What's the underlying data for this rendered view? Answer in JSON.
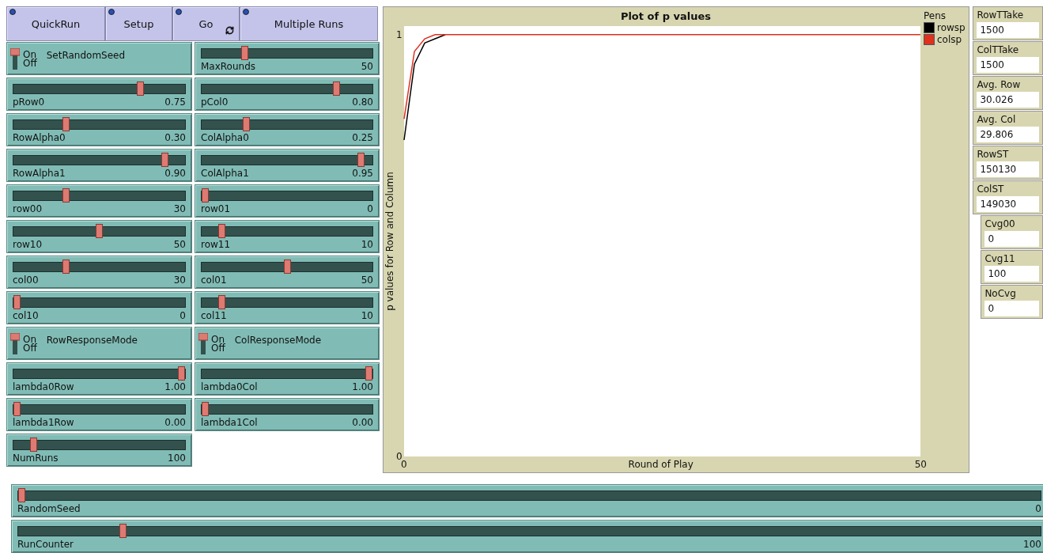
{
  "buttons": [
    {
      "label": "QuickRun",
      "forever": false
    },
    {
      "label": "Setup",
      "forever": false
    },
    {
      "label": "Go",
      "forever": true
    },
    {
      "label": "Multiple Runs",
      "forever": false
    }
  ],
  "widgets": [
    {
      "kind": "switch",
      "label": "SetRandomSeed",
      "on_label": "On",
      "off_label": "Off",
      "on": true
    },
    {
      "kind": "slider",
      "label": "MaxRounds",
      "value": "50",
      "level": 0.24
    },
    {
      "kind": "slider",
      "label": "pRow0",
      "value": "0.75",
      "level": 0.75
    },
    {
      "kind": "slider",
      "label": "pCol0",
      "value": "0.80",
      "level": 0.8
    },
    {
      "kind": "slider",
      "label": "RowAlpha0",
      "value": "0.30",
      "level": 0.3
    },
    {
      "kind": "slider",
      "label": "ColAlpha0",
      "value": "0.25",
      "level": 0.25
    },
    {
      "kind": "slider",
      "label": "RowAlpha1",
      "value": "0.90",
      "level": 0.9
    },
    {
      "kind": "slider",
      "label": "ColAlpha1",
      "value": "0.95",
      "level": 0.95
    },
    {
      "kind": "slider",
      "label": "row00",
      "value": "30",
      "level": 0.3
    },
    {
      "kind": "slider",
      "label": "row01",
      "value": "0",
      "level": 0
    },
    {
      "kind": "slider",
      "label": "row10",
      "value": "50",
      "level": 0.5
    },
    {
      "kind": "slider",
      "label": "row11",
      "value": "10",
      "level": 0.1
    },
    {
      "kind": "slider",
      "label": "col00",
      "value": "30",
      "level": 0.3
    },
    {
      "kind": "slider",
      "label": "col01",
      "value": "50",
      "level": 0.5
    },
    {
      "kind": "slider",
      "label": "col10",
      "value": "0",
      "level": 0
    },
    {
      "kind": "slider",
      "label": "col11",
      "value": "10",
      "level": 0.1
    },
    {
      "kind": "switch",
      "label": "RowResponseMode",
      "on_label": "On",
      "off_label": "Off",
      "on": true
    },
    {
      "kind": "switch",
      "label": "ColResponseMode",
      "on_label": "On",
      "off_label": "Off",
      "on": true
    },
    {
      "kind": "slider",
      "label": "lambda0Row",
      "value": "1.00",
      "level": 1
    },
    {
      "kind": "slider",
      "label": "lambda0Col",
      "value": "1.00",
      "level": 1
    },
    {
      "kind": "slider",
      "label": "lambda1Row",
      "value": "0.00",
      "level": 0
    },
    {
      "kind": "slider",
      "label": "lambda1Col",
      "value": "0.00",
      "level": 0
    },
    {
      "kind": "slider",
      "label": "NumRuns",
      "value": "100",
      "level": 0.1
    }
  ],
  "plot": {
    "legend_title": "Pens",
    "chart_data": {
      "type": "line",
      "legend": true,
      "title": "Plot of p values",
      "xlabel": "Round of Play",
      "ylabel": "p values for Row and Column",
      "x": [
        0,
        1,
        2,
        3,
        4,
        5,
        50
      ],
      "xlim": [
        0,
        50
      ],
      "ylim": [
        0,
        1.02
      ],
      "xticks": [
        0,
        50
      ],
      "yticks": [
        0,
        1
      ],
      "series": [
        {
          "name": "rowsp",
          "color": "#000000",
          "values": [
            0.75,
            0.93,
            0.98,
            0.99,
            1,
            null,
            null
          ]
        },
        {
          "name": "colsp",
          "color": "#e0301e",
          "values": [
            0.8,
            0.96,
            0.99,
            1,
            1,
            1,
            1
          ]
        }
      ]
    }
  },
  "monitors": [
    {
      "label": "RowTTake",
      "value": "1500",
      "indented": false
    },
    {
      "label": "ColTTake",
      "value": "1500",
      "indented": false
    },
    {
      "label": "Avg. Row",
      "value": "30.026",
      "indented": false
    },
    {
      "label": "Avg. Col",
      "value": "29.806",
      "indented": false
    },
    {
      "label": "RowST",
      "value": "150130",
      "indented": false
    },
    {
      "label": "ColST",
      "value": "149030",
      "indented": false
    },
    {
      "label": "Cvg00",
      "value": "0",
      "indented": true
    },
    {
      "label": "Cvg11",
      "value": "100",
      "indented": true
    },
    {
      "label": "NoCvg",
      "value": "0",
      "indented": true
    }
  ],
  "wide_sliders": [
    {
      "label": "RandomSeed",
      "value": "0",
      "level": 0
    },
    {
      "label": "RunCounter",
      "value": "100",
      "level": 0.1
    }
  ]
}
